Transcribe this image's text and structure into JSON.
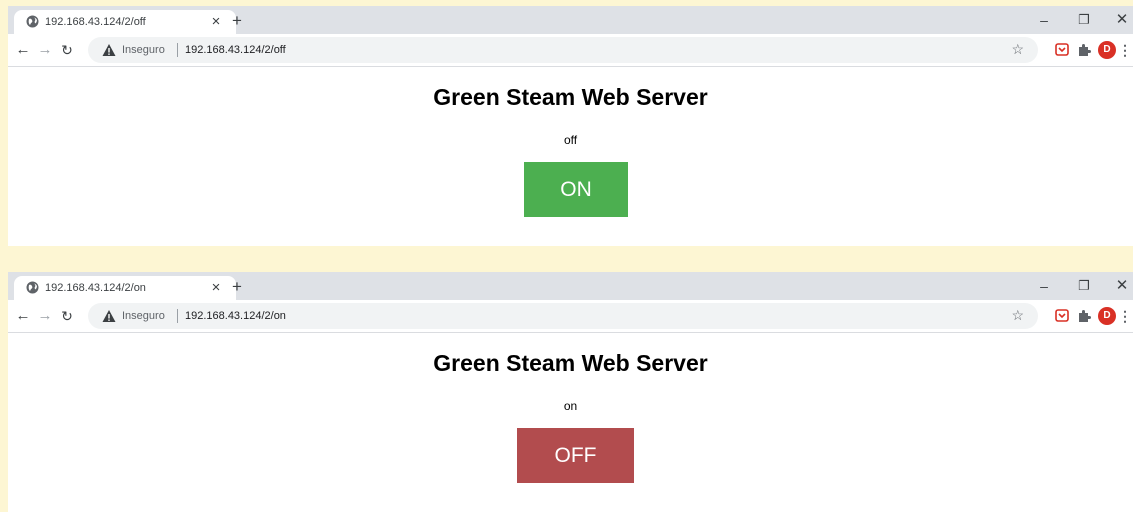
{
  "windows": [
    {
      "tab_title": "192.168.43.124/2/off",
      "security_label": "Inseguro",
      "url": "192.168.43.124/2/off",
      "heading": "Green Steam Web Server",
      "state_text": "off",
      "button_label": "ON",
      "button_color": "#4caf50"
    },
    {
      "tab_title": "192.168.43.124/2/on",
      "security_label": "Inseguro",
      "url": "192.168.43.124/2/on",
      "heading": "Green Steam Web Server",
      "state_text": "on",
      "button_label": "OFF",
      "button_color": "#b24c4e"
    }
  ],
  "browser": {
    "avatar_letter": "D",
    "icons": [
      "globe-icon",
      "close-tab-icon",
      "new-tab-icon",
      "minimize-icon",
      "restore-icon",
      "close-window-icon",
      "back-icon",
      "forward-icon",
      "reload-icon",
      "warning-icon",
      "star-icon",
      "pocket-icon",
      "puzzle-icon",
      "menu-icon"
    ],
    "new_tab_glyph": "+",
    "close_glyph": "×"
  },
  "colors": {
    "page_background": "#fdf6d3",
    "tabstrip": "#dee1e6",
    "avatar": "#d93025"
  }
}
